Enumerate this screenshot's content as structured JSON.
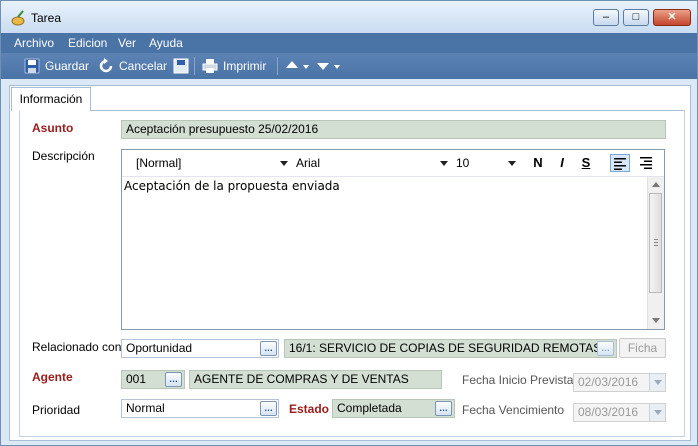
{
  "window": {
    "title": "Tarea",
    "controls": [
      "minimize",
      "maximize",
      "close"
    ]
  },
  "menu": {
    "items": [
      "Archivo",
      "Edicion",
      "Ver",
      "Ayuda"
    ]
  },
  "toolbar": {
    "save_label": "Guardar",
    "cancel_label": "Cancelar",
    "print_label": "Imprimir"
  },
  "tabs": [
    "Información"
  ],
  "form": {
    "asunto": {
      "label": "Asunto",
      "value": "Aceptación presupuesto 25/02/2016"
    },
    "descripcion": {
      "label": "Descripción",
      "style": "[Normal]",
      "font": "Arial",
      "size": "10",
      "bold": "N",
      "italic": "I",
      "underline": "S",
      "text": "Aceptación de la propuesta enviada"
    },
    "relacionado": {
      "label": "Relacionado con",
      "type": "Oportunidad",
      "value": "16/1: SERVICIO DE COPIAS DE SEGURIDAD REMOTAS",
      "ficha_label": "Ficha"
    },
    "agente": {
      "label": "Agente",
      "code": "001",
      "name": "AGENTE DE COMPRAS Y DE VENTAS"
    },
    "fecha_inicio": {
      "label": "Fecha Inicio Prevista",
      "value": "02/03/2016"
    },
    "prioridad": {
      "label": "Prioridad",
      "value": "Normal"
    },
    "estado": {
      "label": "Estado",
      "value": "Completada"
    },
    "fecha_vencimiento": {
      "label": "Fecha Vencimiento",
      "value": "08/03/2016"
    }
  },
  "colors": {
    "menubar": "#4a73a6",
    "required_label": "#9b1c1c",
    "readonly_field": "#d4dfd4"
  }
}
